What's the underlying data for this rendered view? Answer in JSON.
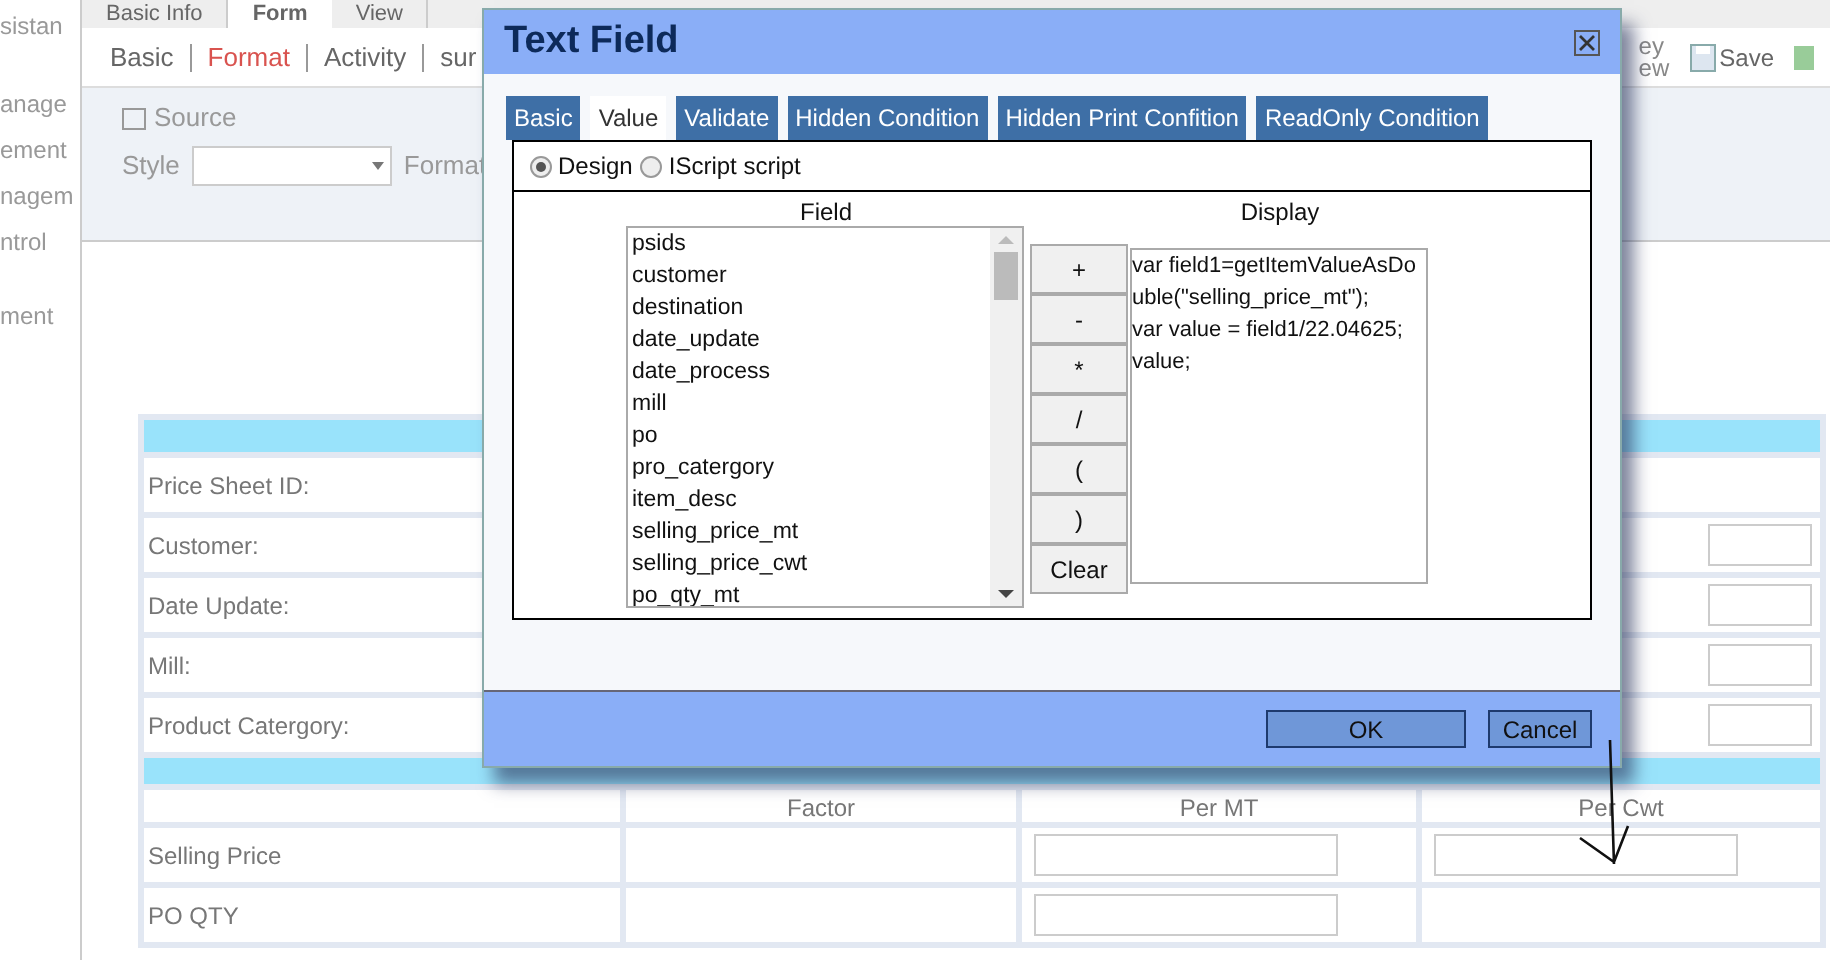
{
  "sidebar": {
    "items": [
      "sistan",
      "anage",
      "ement",
      "nagem",
      "ntrol",
      "ment"
    ]
  },
  "top_tabs": [
    {
      "label": "Basic Info",
      "selected": false
    },
    {
      "label": "Form",
      "selected": true
    },
    {
      "label": "View",
      "selected": false
    }
  ],
  "sub_tabs": [
    {
      "label": "Basic",
      "selected": false
    },
    {
      "label": "Format",
      "selected": true
    },
    {
      "label": "Activity",
      "selected": false
    },
    {
      "label": "sur",
      "selected": false
    }
  ],
  "right_actions": {
    "cut_label_top": "ey",
    "cut_label_bottom": "ew",
    "save": "Save"
  },
  "toolbar": {
    "source": "Source",
    "style_label": "Style",
    "format_label": "Format"
  },
  "form": {
    "fields": [
      {
        "label": "Price Sheet ID:",
        "has_input": false
      },
      {
        "label": "Customer:",
        "has_input": true
      },
      {
        "label": "Date Update:",
        "has_input": true
      },
      {
        "label": "Mill:",
        "has_input": true
      },
      {
        "label": "Product Catergory:",
        "has_input": true
      }
    ],
    "columns": [
      "Factor",
      "Per MT",
      "Per Cwt"
    ],
    "rows": [
      {
        "label": "Selling Price",
        "inputs": [
          false,
          true,
          true
        ]
      },
      {
        "label": "PO QTY",
        "inputs": [
          false,
          true,
          false
        ]
      }
    ]
  },
  "dialog": {
    "title": "Text Field",
    "tabs": [
      {
        "label": "Basic",
        "selected": false
      },
      {
        "label": "Value",
        "selected": true
      },
      {
        "label": "Validate",
        "selected": false
      },
      {
        "label": "Hidden Condition",
        "selected": false
      },
      {
        "label": "Hidden Print Confition",
        "selected": false
      },
      {
        "label": "ReadOnly Condition",
        "selected": false
      }
    ],
    "modes": [
      {
        "label": "Design",
        "selected": true
      },
      {
        "label": "IScript script",
        "selected": false
      }
    ],
    "field_heading": "Field",
    "display_heading": "Display",
    "fields": [
      "psids",
      "customer",
      "destination",
      "date_update",
      "date_process",
      "mill",
      "po",
      "pro_catergory",
      "item_desc",
      "selling_price_mt",
      "selling_price_cwt",
      "po_qty_mt"
    ],
    "operators": [
      "+",
      "-",
      "*",
      "/",
      "(",
      ")",
      "Clear"
    ],
    "display_value": "var field1=getItemValueAsDouble(\"selling_price_mt\");\nvar value = field1/22.04625;\nvalue;",
    "buttons": [
      "OK",
      "Cancel"
    ]
  }
}
